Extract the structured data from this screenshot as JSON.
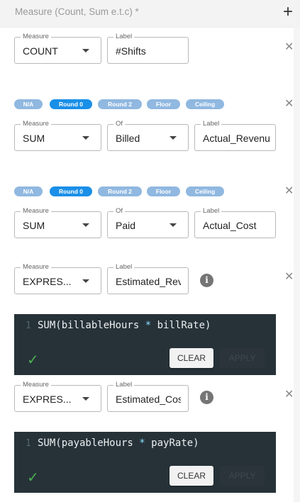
{
  "header": {
    "title": "Measure (Count, Sum e.t.c) *",
    "add_icon": "plus-icon"
  },
  "rounding_options": [
    "N/A",
    "Round 0",
    "Round 2",
    "Floor",
    "Ceiling"
  ],
  "measures": [
    {
      "measure_label": "Measure",
      "measure_value": "COUNT",
      "label_label": "Label",
      "label_value": "#Shifts"
    },
    {
      "active_rounding": "Round 0",
      "measure_label": "Measure",
      "measure_value": "SUM",
      "of_label": "Of",
      "of_value": "Billed",
      "label_label": "Label",
      "label_value": "Actual_Revenu"
    },
    {
      "active_rounding": "Round 0",
      "measure_label": "Measure",
      "measure_value": "SUM",
      "of_label": "Of",
      "of_value": "Paid",
      "label_label": "Label",
      "label_value": "Actual_Cost"
    },
    {
      "measure_label": "Measure",
      "measure_value": "EXPRES...",
      "label_label": "Label",
      "label_value": "Estimated_Rev",
      "editor": {
        "line_number": "1",
        "code_func": "SUM(billableHours",
        "code_op": "*",
        "code_rest": "billRate)",
        "clear_label": "CLEAR",
        "apply_label": "APPLY"
      }
    },
    {
      "measure_label": "Measure",
      "measure_value": "EXPRES...",
      "label_label": "Label",
      "label_value": "Estimated_Cos",
      "editor": {
        "line_number": "1",
        "code_func": "SUM(payableHours",
        "code_op": "*",
        "code_rest": "payRate)",
        "clear_label": "CLEAR",
        "apply_label": "APPLY"
      }
    }
  ],
  "colors": {
    "chip_active": "#1a8fe8",
    "chip_inactive": "#90b8e0",
    "editor_bg": "#263238",
    "check": "#4caf50"
  }
}
